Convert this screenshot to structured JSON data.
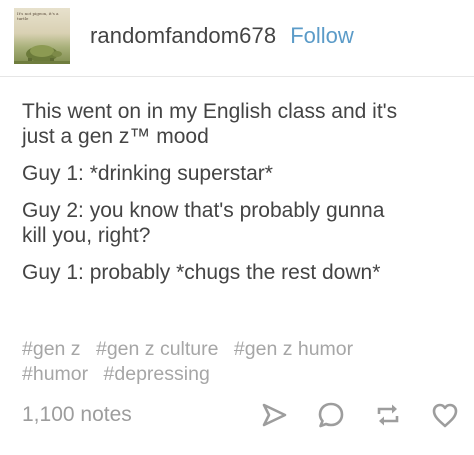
{
  "post": {
    "username": "randomfandom678",
    "follow_label": "Follow",
    "avatar": {
      "caption": "It's not pigeon, it's a turtle"
    },
    "paragraphs": [
      "This went on in my English class and it's\njust a gen z™ mood",
      "Guy 1: *drinking superstar*",
      "Guy 2: you know that's probably gunna\nkill you, right?",
      "Guy 1: probably *chugs the rest down*"
    ],
    "tags": [
      "#gen z",
      "#gen z culture",
      "#gen z humor",
      "#humor",
      "#depressing"
    ],
    "notes": "1,100 notes",
    "actions": {
      "share_icon": "share-icon",
      "reply_icon": "reply-icon",
      "reblog_icon": "reblog-icon",
      "like_icon": "heart-icon"
    },
    "colors": {
      "text": "#444444",
      "link": "#5b9bc8",
      "tag": "#a6a6a6",
      "icon": "#9d9d9d"
    }
  }
}
